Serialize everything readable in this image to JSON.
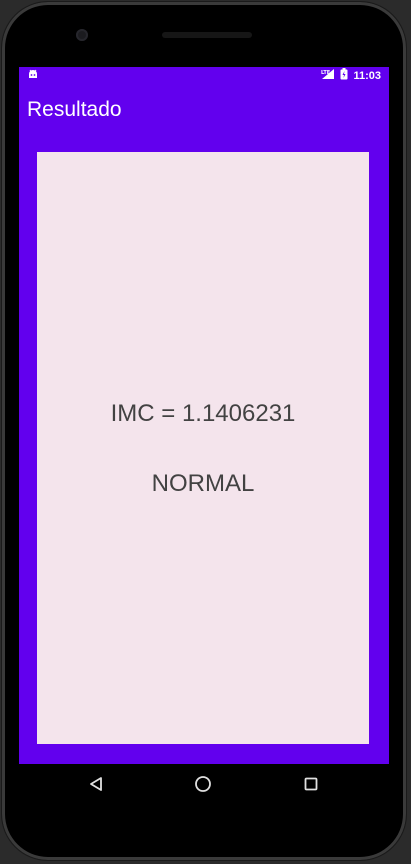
{
  "status_bar": {
    "network": "LTE",
    "time": "11:03"
  },
  "app_bar": {
    "title": "Resultado"
  },
  "result": {
    "imc_text": "IMC = 1.1406231",
    "classification": "NORMAL"
  },
  "colors": {
    "primary": "#6200ee",
    "card_background": "#f4e4ec",
    "text": "#424242"
  },
  "icons": {
    "status_left": "android-debug-icon",
    "signal": "lte-signal-icon",
    "battery": "battery-charging-icon",
    "nav_back": "back-triangle-icon",
    "nav_home": "home-circle-icon",
    "nav_recents": "recents-square-icon"
  }
}
